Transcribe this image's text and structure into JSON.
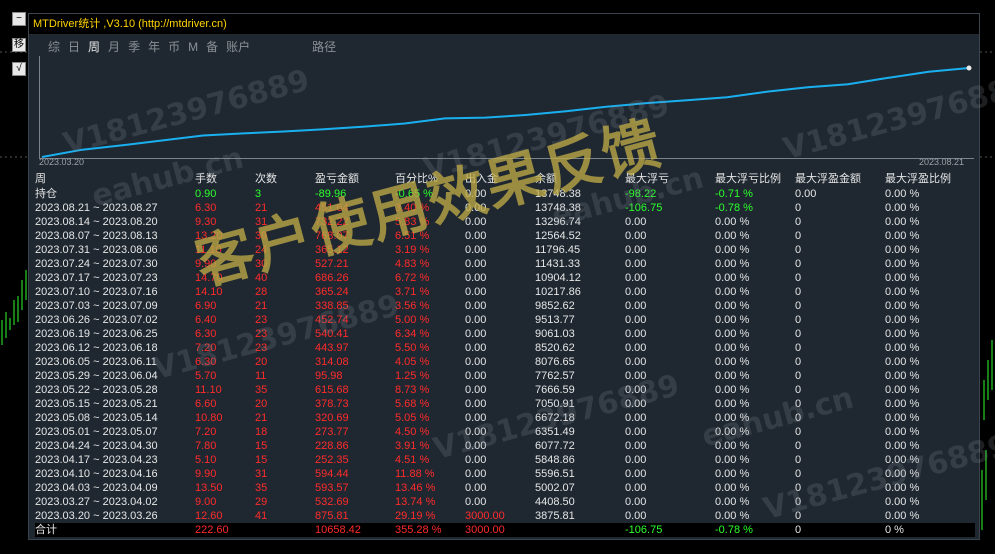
{
  "window": {
    "title": "MTDriver统计 ,V3.10 (http://mtdriver.cn)",
    "side_buttons": [
      "−",
      "移",
      "√"
    ]
  },
  "tabs": [
    {
      "label": "综",
      "active": false
    },
    {
      "label": "日",
      "active": false
    },
    {
      "label": "周",
      "active": true
    },
    {
      "label": "月",
      "active": false
    },
    {
      "label": "季",
      "active": false
    },
    {
      "label": "年",
      "active": false
    },
    {
      "label": "币",
      "active": false
    },
    {
      "label": "M",
      "active": false
    },
    {
      "label": "备",
      "active": false
    },
    {
      "label": "账户",
      "active": false
    },
    {
      "label": "路径",
      "active": false
    }
  ],
  "equity_chart": {
    "start_date": "2023.03.20",
    "end_date": "2023.08.21",
    "line_color": "#1ab0f0",
    "balance": [
      3875.81,
      4408.5,
      5002.07,
      5596.51,
      5848.86,
      6077.72,
      6351.49,
      6672.18,
      7050.91,
      7666.59,
      7762.57,
      8076.65,
      8520.62,
      9061.03,
      9513.77,
      9852.62,
      10217.86,
      10904.12,
      11431.33,
      11796.45,
      12564.52,
      13296.74,
      13748.38
    ]
  },
  "table": {
    "headers": [
      "周",
      "手数",
      "次数",
      "盈亏金额",
      "百分比%",
      "出入金",
      "余额",
      "最大浮亏",
      "最大浮亏比例",
      "最大浮盈金额",
      "最大浮盈比例"
    ],
    "holding": {
      "period": "持仓",
      "lots": "0.90",
      "count": "3",
      "pnl": "-89.96",
      "pct": "-0.65 %",
      "deposit": "0.00",
      "balance": "13748.38",
      "max_dd": "-98.22",
      "max_dd_pct": "-0.71 %",
      "max_fp": "0.00",
      "max_fp_pct": "0.00 %"
    },
    "rows": [
      {
        "period": "2023.08.21 ~ 2023.08.27",
        "lots": "6.30",
        "count": "21",
        "pnl": "451.64",
        "pct": "3.40 %",
        "deposit": "0.00",
        "balance": "13748.38",
        "max_dd": "-106.75",
        "max_dd_pct": "-0.78 %",
        "max_fp": "0",
        "max_fp_pct": "0.00 %"
      },
      {
        "period": "2023.08.14 ~ 2023.08.20",
        "lots": "9.30",
        "count": "31",
        "pnl": "732.22",
        "pct": "5.83 %",
        "deposit": "0.00",
        "balance": "13296.74",
        "max_dd": "0.00",
        "max_dd_pct": "0.00 %",
        "max_fp": "0",
        "max_fp_pct": "0.00 %"
      },
      {
        "period": "2023.08.07 ~ 2023.08.13",
        "lots": "13.20",
        "count": "39",
        "pnl": "768.07",
        "pct": "6.51 %",
        "deposit": "0.00",
        "balance": "12564.52",
        "max_dd": "0.00",
        "max_dd_pct": "0.00 %",
        "max_fp": "0",
        "max_fp_pct": "0.00 %"
      },
      {
        "period": "2023.07.31 ~ 2023.08.06",
        "lots": "11.10",
        "count": "24",
        "pnl": "365.12",
        "pct": "3.19 %",
        "deposit": "0.00",
        "balance": "11796.45",
        "max_dd": "0.00",
        "max_dd_pct": "0.00 %",
        "max_fp": "0",
        "max_fp_pct": "0.00 %"
      },
      {
        "period": "2023.07.24 ~ 2023.07.30",
        "lots": "9.90",
        "count": "30",
        "pnl": "527.21",
        "pct": "4.83 %",
        "deposit": "0.00",
        "balance": "11431.33",
        "max_dd": "0.00",
        "max_dd_pct": "0.00 %",
        "max_fp": "0",
        "max_fp_pct": "0.00 %"
      },
      {
        "period": "2023.07.17 ~ 2023.07.23",
        "lots": "14.70",
        "count": "40",
        "pnl": "686.26",
        "pct": "6.72 %",
        "deposit": "0.00",
        "balance": "10904.12",
        "max_dd": "0.00",
        "max_dd_pct": "0.00 %",
        "max_fp": "0",
        "max_fp_pct": "0.00 %"
      },
      {
        "period": "2023.07.10 ~ 2023.07.16",
        "lots": "14.10",
        "count": "28",
        "pnl": "365.24",
        "pct": "3.71 %",
        "deposit": "0.00",
        "balance": "10217.86",
        "max_dd": "0.00",
        "max_dd_pct": "0.00 %",
        "max_fp": "0",
        "max_fp_pct": "0.00 %"
      },
      {
        "period": "2023.07.03 ~ 2023.07.09",
        "lots": "6.90",
        "count": "21",
        "pnl": "338.85",
        "pct": "3.56 %",
        "deposit": "0.00",
        "balance": "9852.62",
        "max_dd": "0.00",
        "max_dd_pct": "0.00 %",
        "max_fp": "0",
        "max_fp_pct": "0.00 %"
      },
      {
        "period": "2023.06.26 ~ 2023.07.02",
        "lots": "6.40",
        "count": "23",
        "pnl": "452.74",
        "pct": "5.00 %",
        "deposit": "0.00",
        "balance": "9513.77",
        "max_dd": "0.00",
        "max_dd_pct": "0.00 %",
        "max_fp": "0",
        "max_fp_pct": "0.00 %"
      },
      {
        "period": "2023.06.19 ~ 2023.06.25",
        "lots": "6.30",
        "count": "23",
        "pnl": "540.41",
        "pct": "6.34 %",
        "deposit": "0.00",
        "balance": "9061.03",
        "max_dd": "0.00",
        "max_dd_pct": "0.00 %",
        "max_fp": "0",
        "max_fp_pct": "0.00 %"
      },
      {
        "period": "2023.06.12 ~ 2023.06.18",
        "lots": "7.20",
        "count": "23",
        "pnl": "443.97",
        "pct": "5.50 %",
        "deposit": "0.00",
        "balance": "8520.62",
        "max_dd": "0.00",
        "max_dd_pct": "0.00 %",
        "max_fp": "0",
        "max_fp_pct": "0.00 %"
      },
      {
        "period": "2023.06.05 ~ 2023.06.11",
        "lots": "6.30",
        "count": "20",
        "pnl": "314.08",
        "pct": "4.05 %",
        "deposit": "0.00",
        "balance": "8076.65",
        "max_dd": "0.00",
        "max_dd_pct": "0.00 %",
        "max_fp": "0",
        "max_fp_pct": "0.00 %"
      },
      {
        "period": "2023.05.29 ~ 2023.06.04",
        "lots": "5.70",
        "count": "11",
        "pnl": "95.98",
        "pct": "1.25 %",
        "deposit": "0.00",
        "balance": "7762.57",
        "max_dd": "0.00",
        "max_dd_pct": "0.00 %",
        "max_fp": "0",
        "max_fp_pct": "0.00 %"
      },
      {
        "period": "2023.05.22 ~ 2023.05.28",
        "lots": "11.10",
        "count": "35",
        "pnl": "615.68",
        "pct": "8.73 %",
        "deposit": "0.00",
        "balance": "7666.59",
        "max_dd": "0.00",
        "max_dd_pct": "0.00 %",
        "max_fp": "0",
        "max_fp_pct": "0.00 %"
      },
      {
        "period": "2023.05.15 ~ 2023.05.21",
        "lots": "6.60",
        "count": "20",
        "pnl": "378.73",
        "pct": "5.68 %",
        "deposit": "0.00",
        "balance": "7050.91",
        "max_dd": "0.00",
        "max_dd_pct": "0.00 %",
        "max_fp": "0",
        "max_fp_pct": "0.00 %"
      },
      {
        "period": "2023.05.08 ~ 2023.05.14",
        "lots": "10.80",
        "count": "21",
        "pnl": "320.69",
        "pct": "5.05 %",
        "deposit": "0.00",
        "balance": "6672.18",
        "max_dd": "0.00",
        "max_dd_pct": "0.00 %",
        "max_fp": "0",
        "max_fp_pct": "0.00 %"
      },
      {
        "period": "2023.05.01 ~ 2023.05.07",
        "lots": "7.20",
        "count": "18",
        "pnl": "273.77",
        "pct": "4.50 %",
        "deposit": "0.00",
        "balance": "6351.49",
        "max_dd": "0.00",
        "max_dd_pct": "0.00 %",
        "max_fp": "0",
        "max_fp_pct": "0.00 %"
      },
      {
        "period": "2023.04.24 ~ 2023.04.30",
        "lots": "7.80",
        "count": "15",
        "pnl": "228.86",
        "pct": "3.91 %",
        "deposit": "0.00",
        "balance": "6077.72",
        "max_dd": "0.00",
        "max_dd_pct": "0.00 %",
        "max_fp": "0",
        "max_fp_pct": "0.00 %"
      },
      {
        "period": "2023.04.17 ~ 2023.04.23",
        "lots": "5.10",
        "count": "15",
        "pnl": "252.35",
        "pct": "4.51 %",
        "deposit": "0.00",
        "balance": "5848.86",
        "max_dd": "0.00",
        "max_dd_pct": "0.00 %",
        "max_fp": "0",
        "max_fp_pct": "0.00 %"
      },
      {
        "period": "2023.04.10 ~ 2023.04.16",
        "lots": "9.90",
        "count": "31",
        "pnl": "594.44",
        "pct": "11.88 %",
        "deposit": "0.00",
        "balance": "5596.51",
        "max_dd": "0.00",
        "max_dd_pct": "0.00 %",
        "max_fp": "0",
        "max_fp_pct": "0.00 %"
      },
      {
        "period": "2023.04.03 ~ 2023.04.09",
        "lots": "13.50",
        "count": "35",
        "pnl": "593.57",
        "pct": "13.46 %",
        "deposit": "0.00",
        "balance": "5002.07",
        "max_dd": "0.00",
        "max_dd_pct": "0.00 %",
        "max_fp": "0",
        "max_fp_pct": "0.00 %"
      },
      {
        "period": "2023.03.27 ~ 2023.04.02",
        "lots": "9.00",
        "count": "29",
        "pnl": "532.69",
        "pct": "13.74 %",
        "deposit": "0.00",
        "balance": "4408.50",
        "max_dd": "0.00",
        "max_dd_pct": "0.00 %",
        "max_fp": "0",
        "max_fp_pct": "0.00 %"
      },
      {
        "period": "2023.03.20 ~ 2023.03.26",
        "lots": "12.60",
        "count": "41",
        "pnl": "875.81",
        "pct": "29.19 %",
        "deposit": "3000.00",
        "balance": "3875.81",
        "max_dd": "0.00",
        "max_dd_pct": "0.00 %",
        "max_fp": "0",
        "max_fp_pct": "0.00 %"
      }
    ],
    "total": {
      "period": "合计",
      "lots": "222.60",
      "count": "",
      "pnl": "10658.42",
      "pct": "355.28 %",
      "deposit": "3000.00",
      "balance": "",
      "max_dd": "-106.75",
      "max_dd_pct": "-0.78 %",
      "max_fp": "0",
      "max_fp_pct": "0 %"
    }
  },
  "watermarks": {
    "main": "客户使用效果反馈",
    "small": [
      "V18123976889",
      "eahub.cn"
    ]
  },
  "colors": {
    "profit": "#ff2a2a",
    "holding": "#2cff2c",
    "title": "#ffd400"
  }
}
